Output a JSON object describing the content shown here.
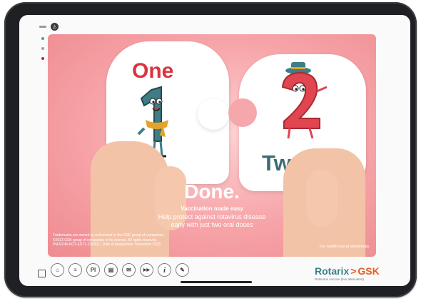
{
  "topbar": {
    "logo_glyph": "◬"
  },
  "side_nav": [
    {
      "color": "#4caf50"
    },
    {
      "color": "#9e9e9e"
    },
    {
      "color": "#c62828"
    }
  ],
  "hero": {
    "word_one": "One",
    "word_two": "Two",
    "char_one_glyph": "1",
    "char_two_glyph": "2",
    "headline": "Done.",
    "tagline": "Vaccination made easy",
    "description_line1": "Help protect against rotavirus disease",
    "description_line2": "early with just two oral doses",
    "legal_line1": "Trademarks are owned by or licensed to the GSK group of companies.",
    "legal_line2": "©2023 GSK group of companies or its licensor. All rights reserved.",
    "legal_line3": "PM-ROM-ROT-EDTL-230001 | Date of preparation: November 2023",
    "hcp_note": "For healthcare professionals"
  },
  "toolbar": {
    "buttons": [
      {
        "icon": "home-icon",
        "glyph": "⌂"
      },
      {
        "icon": "menu-icon",
        "glyph": "≡"
      },
      {
        "icon": "pi-icon",
        "glyph": "PI"
      },
      {
        "icon": "document-icon",
        "glyph": "▤"
      },
      {
        "icon": "email-icon",
        "glyph": "✉"
      },
      {
        "icon": "fast-forward-icon",
        "glyph": "▶▶"
      },
      {
        "icon": "info-icon",
        "glyph": "i"
      },
      {
        "icon": "pen-icon",
        "glyph": "✎"
      }
    ]
  },
  "brand": {
    "product": "Rotarix",
    "separator": ">",
    "company": "GSK",
    "subtitle": "Rotavirus vaccine (live attenuated)"
  },
  "colors": {
    "accent_red": "#d9343f",
    "accent_teal": "#3d6b72",
    "gsk_orange": "#ea5a1b",
    "hero_pink": "#f6a3a7"
  }
}
